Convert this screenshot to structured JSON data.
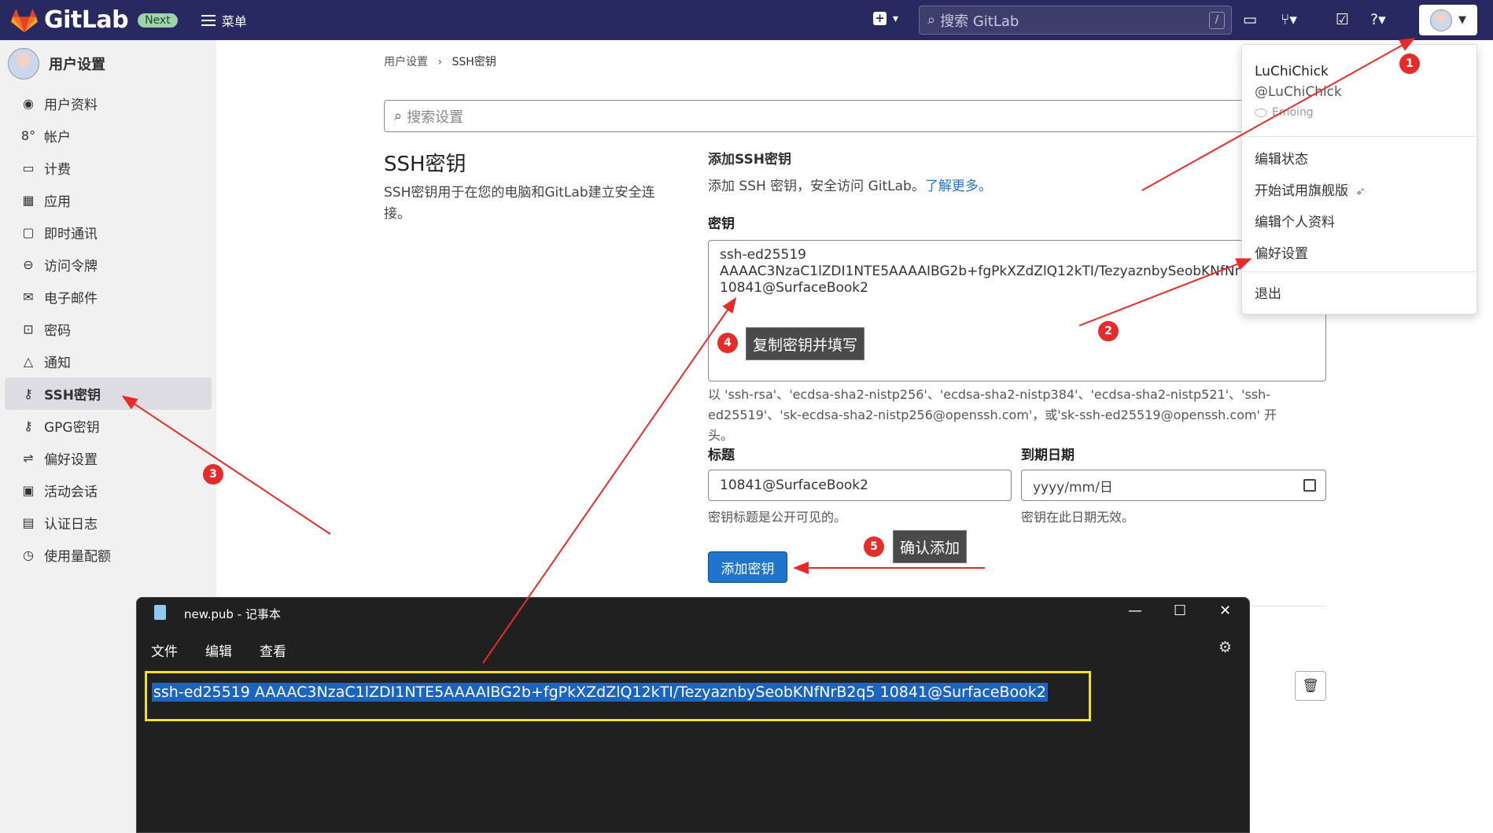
{
  "topbar": {
    "logo_text": "GitLab",
    "badge": "Next",
    "menu_label": "菜单",
    "search_placeholder": "搜索 GitLab",
    "search_shortcut": "/",
    "plus_caret": "⌄"
  },
  "sidebar": {
    "title": "用户设置",
    "items": [
      {
        "label": "用户资料",
        "icon": "user-circle-icon"
      },
      {
        "label": "帐户",
        "icon": "account-icon"
      },
      {
        "label": "计费",
        "icon": "credit-card-icon"
      },
      {
        "label": "应用",
        "icon": "apps-icon"
      },
      {
        "label": "即时通讯",
        "icon": "chat-icon"
      },
      {
        "label": "访问令牌",
        "icon": "token-icon"
      },
      {
        "label": "电子邮件",
        "icon": "mail-icon"
      },
      {
        "label": "密码",
        "icon": "lock-icon"
      },
      {
        "label": "通知",
        "icon": "bell-icon"
      },
      {
        "label": "SSH密钥",
        "icon": "key-icon"
      },
      {
        "label": "GPG密钥",
        "icon": "key-icon"
      },
      {
        "label": "偏好设置",
        "icon": "sliders-icon"
      },
      {
        "label": "活动会话",
        "icon": "monitor-icon"
      },
      {
        "label": "认证日志",
        "icon": "log-icon"
      },
      {
        "label": "使用量配额",
        "icon": "quota-icon"
      }
    ]
  },
  "main": {
    "breadcrumb": [
      "用户设置",
      "SSH密钥"
    ],
    "search_placeholder": "搜索设置",
    "section_title": "SSH密钥",
    "section_desc": "SSH密钥用于在您的电脑和GitLab建立安全连接。",
    "add_title": "添加SSH密钥",
    "add_desc": "添加 SSH 密钥，安全访问 GitLab。",
    "add_link": "了解更多。",
    "key_label": "密钥",
    "key_value": "ssh-ed25519 AAAAC3NzaC1lZDI1NTE5AAAAIBG2b+fgPkXZdZlQ12kTI/TezyaznbySeobKNfNrB2q5 10841@SurfaceBook2",
    "key_help": "以 'ssh-rsa'、'ecdsa-sha2-nistp256'、'ecdsa-sha2-nistp384'、'ecdsa-sha2-nistp521'、'ssh-ed25519'、'sk-ecdsa-sha2-nistp256@openssh.com'，或'sk-ssh-ed25519@openssh.com' 开头。",
    "title_label": "标题",
    "title_value": "10841@SurfaceBook2",
    "title_help": "密钥标题是公开可见的。",
    "expiry_label": "到期日期",
    "expiry_placeholder": "yyyy/mm/日",
    "expiry_help": "密钥在此日期无效。",
    "add_button": "添加密钥"
  },
  "user_menu": {
    "name": "LuChiChick",
    "handle": "@LuChiChick",
    "status": "Emoing",
    "items": [
      "编辑状态",
      "开始试用旗舰版",
      "编辑个人资料",
      "偏好设置",
      "退出"
    ]
  },
  "notepad": {
    "title": "new.pub - 记事本",
    "menu": [
      "文件",
      "编辑",
      "查看"
    ],
    "content": "ssh-ed25519 AAAAC3NzaC1lZDI1NTE5AAAAIBG2b+fgPkXZdZlQ12kTI/TezyaznbySeobKNfNrB2q5 10841@SurfaceBook2"
  },
  "annotations": {
    "steps": [
      "1",
      "2",
      "3",
      "4",
      "5"
    ],
    "tip_copy": "复制密钥并填写",
    "tip_confirm": "确认添加",
    "color": "#e62b2b"
  }
}
